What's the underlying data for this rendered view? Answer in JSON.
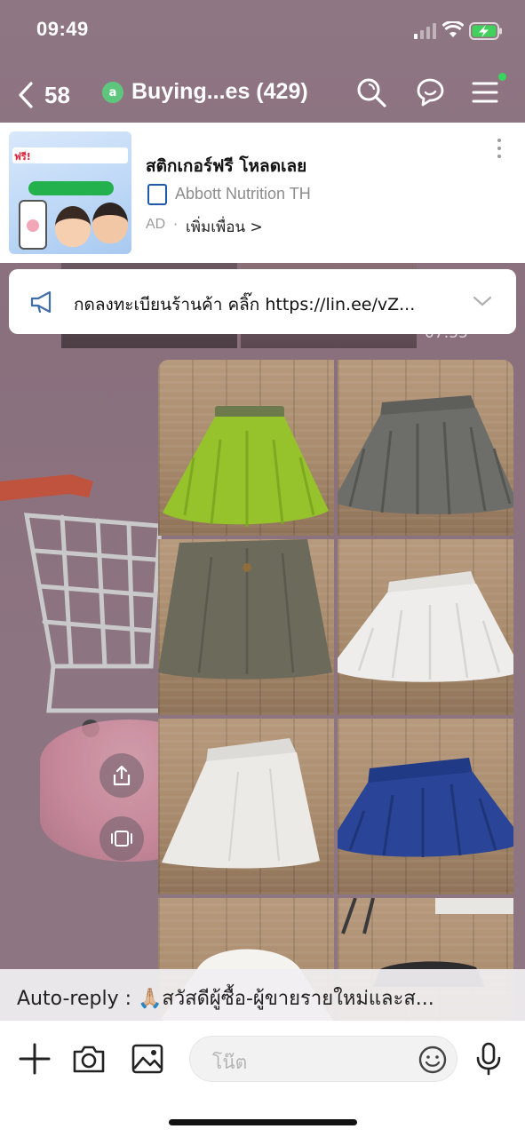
{
  "status_bar": {
    "time": "09:49"
  },
  "header": {
    "back_count": "58",
    "group_badge": "a",
    "title": "Buying...es (429)"
  },
  "ad": {
    "thumb_free": "ฟรี!",
    "title": "สติกเกอร์ฟรี โหลดเลย",
    "brand": "Abbott Nutrition TH",
    "tag": "AD",
    "add_friend": "เพิ่มเพื่อน >"
  },
  "announcement": {
    "text": "กดลงทะเบียนร้านค้า คลิ๊ก  https://lin.ee/vZ..."
  },
  "ghost_time": "07:55",
  "auto_reply": {
    "text": "Auto-reply : 🙏🏼สวัสดีผู้ซื้อ-ผู้ขายรายใหม่และส..."
  },
  "input": {
    "placeholder": "โน๊ต"
  },
  "colors": {
    "accent_green": "#5fc77d",
    "online_dot": "#36d55c",
    "chat_bg": "#8f7683"
  },
  "photos": [
    {
      "item": "green tulle skirt",
      "color": "#9ac62f"
    },
    {
      "item": "grey pleated skirt",
      "color": "#6b6b68"
    },
    {
      "item": "olive grey skirt",
      "color": "#6a6959"
    },
    {
      "item": "white pleated skirt",
      "color": "#ecebea"
    },
    {
      "item": "white a-line skirt",
      "color": "#e9e8e4"
    },
    {
      "item": "navy blue pleated skirt",
      "color": "#243f92"
    },
    {
      "item": "white skirt",
      "color": "#f1f0ee"
    },
    {
      "item": "dark skirt",
      "color": "#2c2b2e"
    }
  ]
}
